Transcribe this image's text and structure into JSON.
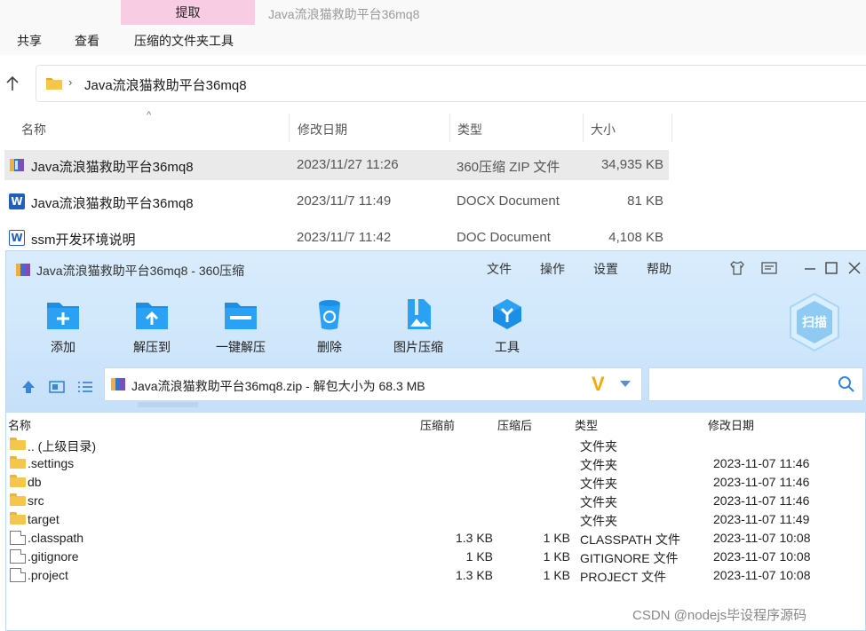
{
  "explorer": {
    "extract_tab": "提取",
    "window_title": "Java流浪猫救助平台36mq8",
    "ribbon_tabs": [
      "共享",
      "查看",
      "压缩的文件夹工具"
    ],
    "address": {
      "path": "Java流浪猫救助平台36mq8"
    },
    "columns": {
      "name": "名称",
      "modified": "修改日期",
      "type": "类型",
      "size": "大小"
    },
    "files": [
      {
        "name": "Java流浪猫救助平台36mq8",
        "date": "2023/11/27 11:26",
        "type": "360压缩 ZIP 文件",
        "size": "34,935 KB",
        "icon": "zip-archive-icon",
        "selected": true
      },
      {
        "name": "Java流浪猫救助平台36mq8",
        "date": "2023/11/7 11:49",
        "type": "DOCX Document",
        "size": "81 KB",
        "icon": "word-icon"
      },
      {
        "name": "ssm开发环境说明",
        "date": "2023/11/7 11:42",
        "type": "DOC Document",
        "size": "4,108 KB",
        "icon": "word-doc-icon"
      }
    ]
  },
  "zip": {
    "title": "Java流浪猫救助平台36mq8 - 360压缩",
    "menu": [
      "文件",
      "操作",
      "设置",
      "帮助"
    ],
    "toolbar": [
      {
        "label": "添加",
        "icon": "add-icon"
      },
      {
        "label": "解压到",
        "icon": "extract-to-icon"
      },
      {
        "label": "一键解压",
        "icon": "one-click-extract-icon"
      },
      {
        "label": "删除",
        "icon": "delete-icon"
      },
      {
        "label": "图片压缩",
        "icon": "image-compress-icon"
      },
      {
        "label": "工具",
        "icon": "tools-icon"
      }
    ],
    "scan_label": "扫描",
    "path_text": "Java流浪猫救助平台36mq8.zip - 解包大小为 68.3 MB",
    "search": {
      "placeholder": ""
    },
    "columns": {
      "name": "名称",
      "before": "压缩前",
      "after": "压缩后",
      "type": "类型",
      "modified": "修改日期"
    },
    "rows": [
      {
        "name": ".. (上级目录)",
        "before": "",
        "after": "",
        "type": "文件夹",
        "date": "",
        "icon": "folder-icon"
      },
      {
        "name": ".settings",
        "before": "",
        "after": "",
        "type": "文件夹",
        "date": "2023-11-07 11:46",
        "icon": "folder-icon"
      },
      {
        "name": "db",
        "before": "",
        "after": "",
        "type": "文件夹",
        "date": "2023-11-07 11:46",
        "icon": "folder-icon"
      },
      {
        "name": "src",
        "before": "",
        "after": "",
        "type": "文件夹",
        "date": "2023-11-07 11:46",
        "icon": "folder-icon"
      },
      {
        "name": "target",
        "before": "",
        "after": "",
        "type": "文件夹",
        "date": "2023-11-07 11:49",
        "icon": "folder-icon"
      },
      {
        "name": ".classpath",
        "before": "1.3 KB",
        "after": "1 KB",
        "type": "CLASSPATH 文件",
        "date": "2023-11-07 10:08",
        "icon": "file-icon"
      },
      {
        "name": ".gitignore",
        "before": "1 KB",
        "after": "1 KB",
        "type": "GITIGNORE 文件",
        "date": "2023-11-07 10:08",
        "icon": "file-icon"
      },
      {
        "name": ".project",
        "before": "1.3 KB",
        "after": "1 KB",
        "type": "PROJECT 文件",
        "date": "2023-11-07 10:08",
        "icon": "file-icon"
      }
    ]
  },
  "watermark": "CSDN @nodejs毕设程序源码"
}
